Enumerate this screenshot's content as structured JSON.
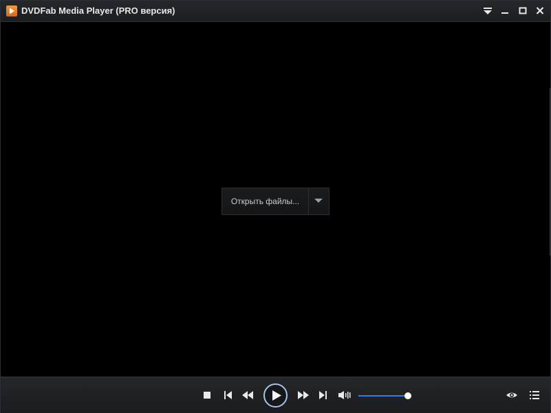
{
  "window": {
    "title": "DVDFab Media Player (PRO версия)",
    "accent_color": "#e57a25"
  },
  "titlebar": {
    "buttons": [
      "dropdown-menu",
      "minimize",
      "maximize",
      "close"
    ]
  },
  "video_area": {
    "open_files_label": "Открыть файлы...",
    "open_files_dropdown_icon": "chevron-down-icon"
  },
  "controls": {
    "buttons": [
      "stop",
      "previous",
      "rewind",
      "play",
      "fast-forward",
      "next",
      "volume",
      "view",
      "playlist"
    ],
    "volume_level": 1.0,
    "volume_color": "#2f7de0"
  }
}
